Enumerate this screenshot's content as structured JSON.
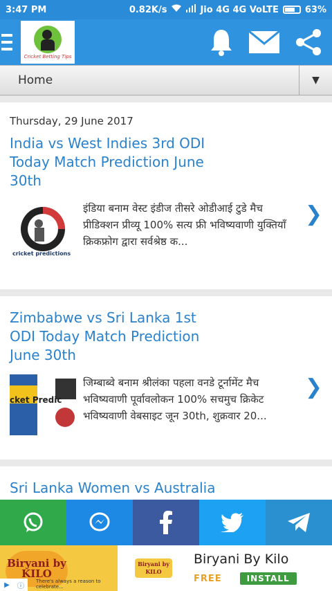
{
  "status_bar": {
    "time": "3:47 PM",
    "speed": "0.82K/s",
    "carrier": "Jio 4G 4G VoLTE",
    "battery": "63%"
  },
  "app_bar": {
    "logo_caption": "Cricket Betting Tips"
  },
  "nav": {
    "selected": "Home",
    "arrow": "▼"
  },
  "posts": [
    {
      "date": "Thursday, 29 June 2017",
      "title": "India vs West Indies 3rd ODI Today Match Prediction June 30th",
      "excerpt": "इंडिया बनाम वेस्ट इंडीज तीसरे ओडीआई टुडे मैच प्रीडिक्शन प्रीव्यू 100% सत्य फ्री भविष्यवाणी युक्तियाँ क्रिकफ्रोग द्वारा सर्वश्रेष्ठ क...",
      "thumb_caption": "cricket predictions"
    },
    {
      "date": "",
      "title": "Zimbabwe vs Sri Lanka 1st ODI Today Match Prediction June 30th",
      "excerpt": "जिम्बाब्वे बनाम श्रीलंका पहला वनडे टूर्नामेंट मैच भविष्यवाणी पूर्वावलोकन 100% सचमुच क्रिकेट भविष्यवाणी वेबसाइट जून 30th, शुक्रवार 20...",
      "thumb_caption": "cket Predic"
    },
    {
      "date": "",
      "title": "Sri Lanka Women vs Australia",
      "excerpt": "",
      "thumb_caption": ""
    }
  ],
  "share": [
    {
      "icon": "whatsapp-icon",
      "color": "#30a94b"
    },
    {
      "icon": "messenger-icon",
      "color": "#1e88e5"
    },
    {
      "icon": "facebook-icon",
      "color": "#3b5aa0"
    },
    {
      "icon": "twitter-icon",
      "color": "#1da1f2"
    },
    {
      "icon": "telegram-icon",
      "color": "#2b90d0"
    }
  ],
  "ad": {
    "banner_text": "Biryani by KILO",
    "icon_text": "Biryani by KILO",
    "tagline": "There's always a reason to celebrate...",
    "name": "Biryani By Kilo",
    "free": "FREE",
    "install": "INSTALL"
  },
  "chevron": "❯"
}
